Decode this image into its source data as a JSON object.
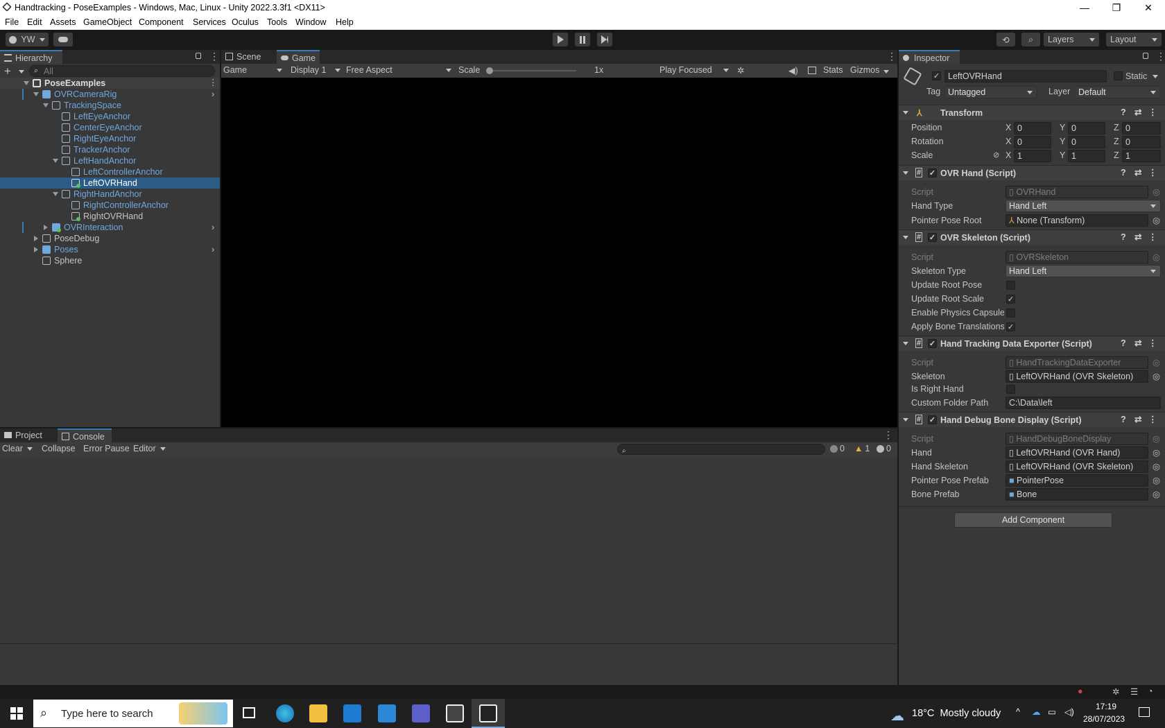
{
  "window": {
    "title": "Handtracking - PoseExamples - Windows, Mac, Linux - Unity 2022.3.3f1 <DX11>",
    "min": "—",
    "max": "❐",
    "close": "✕"
  },
  "menu": [
    "File",
    "Edit",
    "Assets",
    "GameObject",
    "Component",
    "Services",
    "Oculus",
    "Tools",
    "Window",
    "Help"
  ],
  "toolbar": {
    "account": "YW",
    "layers": "Layers",
    "layout": "Layout"
  },
  "hierarchy": {
    "tab": "Hierarchy",
    "search_placeholder": "All",
    "items": [
      {
        "label": "PoseExamples"
      },
      {
        "label": "OVRCameraRig"
      },
      {
        "label": "TrackingSpace"
      },
      {
        "label": "LeftEyeAnchor"
      },
      {
        "label": "CenterEyeAnchor"
      },
      {
        "label": "RightEyeAnchor"
      },
      {
        "label": "TrackerAnchor"
      },
      {
        "label": "LeftHandAnchor"
      },
      {
        "label": "LeftControllerAnchor"
      },
      {
        "label": "LeftOVRHand"
      },
      {
        "label": "RightHandAnchor"
      },
      {
        "label": "RightControllerAnchor"
      },
      {
        "label": "RightOVRHand"
      },
      {
        "label": "OVRInteraction"
      },
      {
        "label": "PoseDebug"
      },
      {
        "label": "Poses"
      },
      {
        "label": "Sphere"
      }
    ]
  },
  "game": {
    "tabs": [
      "Scene",
      "Game"
    ],
    "view_mode": "Game",
    "display": "Display 1",
    "aspect": "Free Aspect",
    "scale_label": "Scale",
    "scale_value": "1x",
    "scale_fraction": 0,
    "play_mode": "Play Focused",
    "stats": "Stats",
    "gizmos": "Gizmos"
  },
  "inspector": {
    "tab": "Inspector",
    "object_name": "LeftOVRHand",
    "static_label": "Static",
    "tag_label": "Tag",
    "tag_value": "Untagged",
    "layer_label": "Layer",
    "layer_value": "Default",
    "transform": {
      "title": "Transform",
      "position_label": "Position",
      "position": [
        "0",
        "0",
        "0"
      ],
      "rotation_label": "Rotation",
      "rotation": [
        "0",
        "0",
        "0"
      ],
      "scale_label": "Scale",
      "scale": [
        "1",
        "1",
        "1"
      ],
      "axes": [
        "X",
        "Y",
        "Z"
      ]
    },
    "ovr_hand": {
      "title": "OVR Hand (Script)",
      "script_label": "Script",
      "script_value": "OVRHand",
      "hand_type_label": "Hand Type",
      "hand_type_value": "Hand Left",
      "pointer_label": "Pointer Pose Root",
      "pointer_value": "None (Transform)"
    },
    "ovr_skeleton": {
      "title": "OVR Skeleton (Script)",
      "script_label": "Script",
      "script_value": "OVRSkeleton",
      "skeleton_type_label": "Skeleton Type",
      "skeleton_type_value": "Hand Left",
      "update_root_pose": "Update Root Pose",
      "update_root_scale": "Update Root Scale",
      "enable_physics": "Enable Physics Capsule",
      "apply_bone": "Apply Bone Translations"
    },
    "exporter": {
      "title": "Hand Tracking Data Exporter (Script)",
      "script_label": "Script",
      "script_value": "HandTrackingDataExporter",
      "skeleton_label": "Skeleton",
      "skeleton_value": "LeftOVRHand (OVR Skeleton)",
      "is_right_label": "Is Right Hand",
      "folder_label": "Custom Folder Path",
      "folder_value": "C:\\Data\\left"
    },
    "debug": {
      "title": "Hand Debug Bone Display (Script)",
      "script_label": "Script",
      "script_value": "HandDebugBoneDisplay",
      "hand_label": "Hand",
      "hand_value": "LeftOVRHand (OVR Hand)",
      "hand_skeleton_label": "Hand Skeleton",
      "hand_skeleton_value": "LeftOVRHand (OVR Skeleton)",
      "pointer_prefab_label": "Pointer Pose Prefab",
      "pointer_prefab_value": "PointerPose",
      "bone_prefab_label": "Bone Prefab",
      "bone_prefab_value": "Bone"
    },
    "add_component": "Add Component"
  },
  "console": {
    "tabs": [
      "Project",
      "Console"
    ],
    "clear": "Clear",
    "collapse": "Collapse",
    "error_pause": "Error Pause",
    "editor": "Editor",
    "count_log": "0",
    "count_warn": "1",
    "count_error": "0"
  },
  "taskbar": {
    "search_placeholder": "Type here to search",
    "weather": "18°C  Mostly cloudy",
    "time": "17:19",
    "date": "28/07/2023"
  },
  "colors": {
    "accent": "#3a79bb",
    "selection": "#2c5d87",
    "prefab_blue": "#6fa8dc"
  }
}
